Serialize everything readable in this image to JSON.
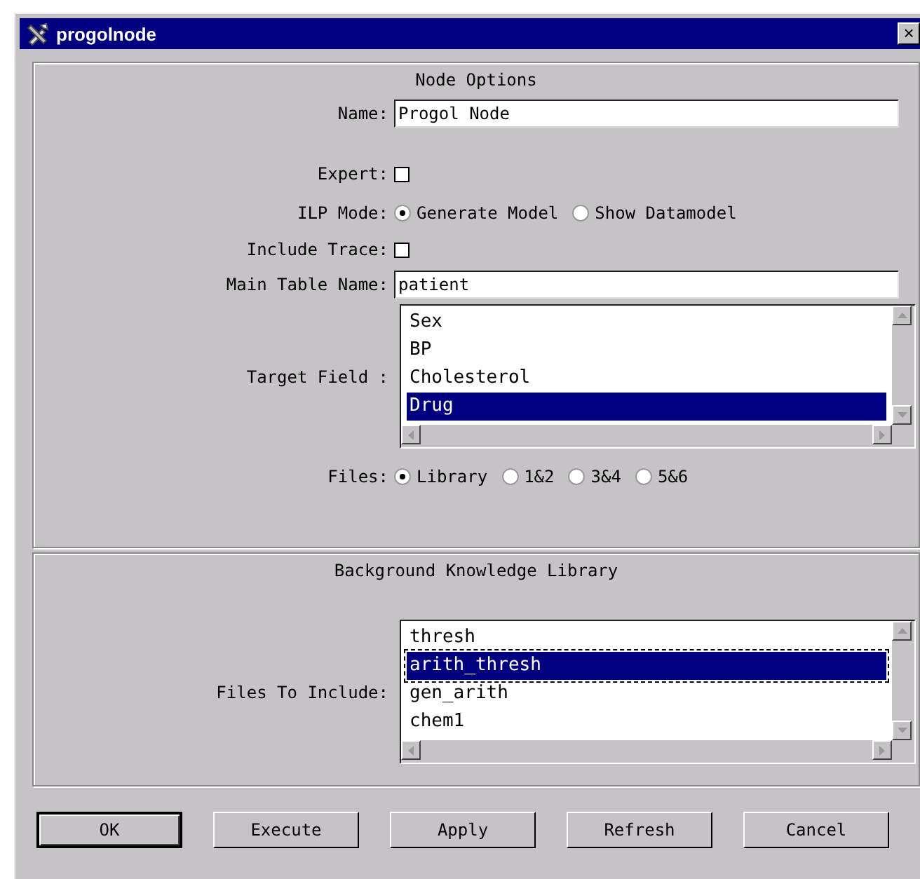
{
  "window": {
    "title": "progolnode",
    "close": "×"
  },
  "node_options": {
    "heading": "Node Options",
    "name": {
      "label": "Name:",
      "value": "Progol Node"
    },
    "expert": {
      "label": "Expert:",
      "checked": false
    },
    "ilp_mode": {
      "label": "ILP Mode:",
      "options": [
        {
          "label": "Generate Model",
          "selected": true
        },
        {
          "label": "Show Datamodel",
          "selected": false
        }
      ]
    },
    "include_trace": {
      "label": "Include Trace:",
      "checked": false
    },
    "main_table_name": {
      "label": "Main Table Name:",
      "value": "patient"
    },
    "target_field": {
      "label": "Target Field :",
      "items": [
        {
          "label": "Sex",
          "selected": false,
          "focused": false
        },
        {
          "label": "BP",
          "selected": false,
          "focused": false
        },
        {
          "label": "Cholesterol",
          "selected": false,
          "focused": false
        },
        {
          "label": "Drug",
          "selected": true,
          "focused": false
        }
      ]
    },
    "files": {
      "label": "Files:",
      "options": [
        {
          "label": "Library",
          "selected": true
        },
        {
          "label": "1&2",
          "selected": false
        },
        {
          "label": "3&4",
          "selected": false
        },
        {
          "label": "5&6",
          "selected": false
        }
      ]
    }
  },
  "background_library": {
    "heading": "Background Knowledge Library",
    "files_to_include": {
      "label": "Files To Include:",
      "items": [
        {
          "label": "thresh",
          "selected": false,
          "focused": false
        },
        {
          "label": "arith_thresh",
          "selected": true,
          "focused": true
        },
        {
          "label": "gen_arith",
          "selected": false,
          "focused": false
        },
        {
          "label": "chem1",
          "selected": false,
          "focused": false
        }
      ]
    }
  },
  "buttons": [
    {
      "label": "OK",
      "default": true
    },
    {
      "label": "Execute",
      "default": false
    },
    {
      "label": "Apply",
      "default": false
    },
    {
      "label": "Refresh",
      "default": false
    },
    {
      "label": "Cancel",
      "default": false
    }
  ]
}
